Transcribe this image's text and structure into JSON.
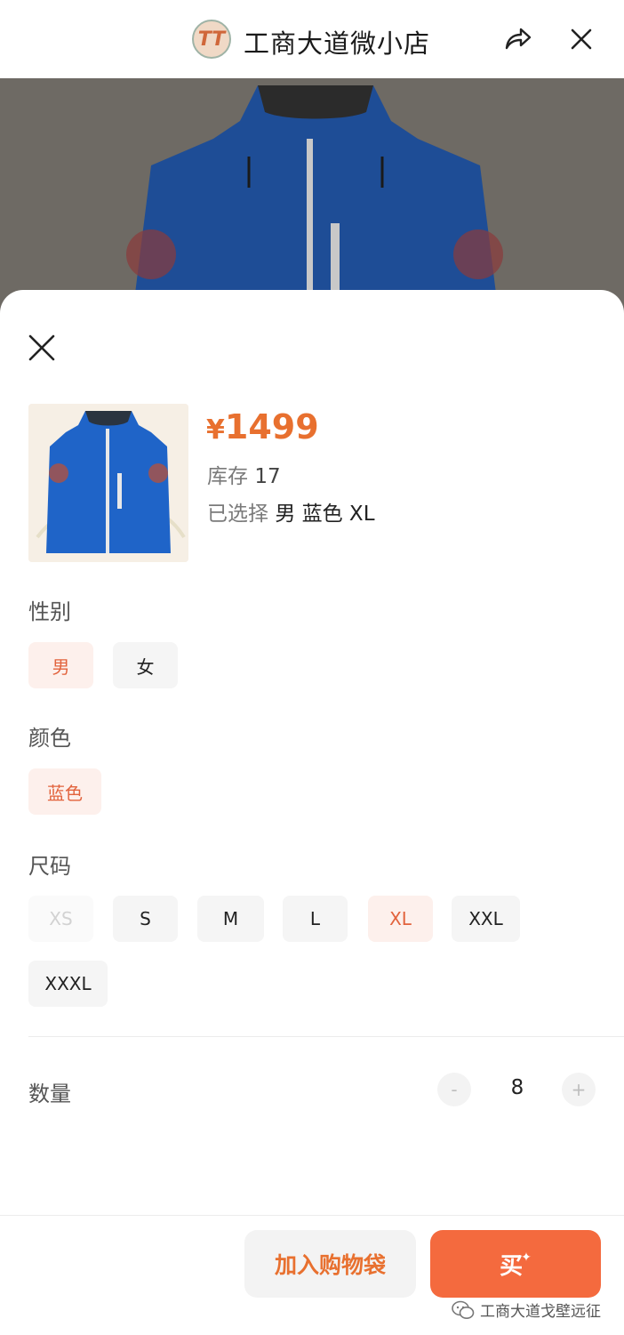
{
  "header": {
    "shop_title": "工商大道微小店",
    "logo_text": "TT"
  },
  "product": {
    "price_symbol": "¥",
    "price_value": "1499",
    "stock_label": "库存",
    "stock_value": "17",
    "selected_label": "已选择",
    "selected_value": "男 蓝色 XL"
  },
  "options": {
    "gender": {
      "label": "性别",
      "items": [
        {
          "label": "男",
          "state": "selected"
        },
        {
          "label": "女",
          "state": "normal"
        }
      ]
    },
    "color": {
      "label": "颜色",
      "items": [
        {
          "label": "蓝色",
          "state": "selected"
        }
      ]
    },
    "size": {
      "label": "尺码",
      "items": [
        {
          "label": "XS",
          "state": "disabled"
        },
        {
          "label": "S",
          "state": "normal"
        },
        {
          "label": "M",
          "state": "normal"
        },
        {
          "label": "L",
          "state": "normal"
        },
        {
          "label": "XL",
          "state": "selected"
        },
        {
          "label": "XXL",
          "state": "normal"
        },
        {
          "label": "XXXL",
          "state": "normal"
        }
      ]
    }
  },
  "quantity": {
    "label": "数量",
    "minus": "-",
    "value": "8",
    "plus": "+"
  },
  "actions": {
    "add_to_bag": "加入购物袋",
    "buy": "买"
  },
  "watermark": "工商大道戈壁远征",
  "colors": {
    "accent": "#e8702f",
    "buy_button": "#f46a3e",
    "selected_bg": "#fdf0ec",
    "jacket_blue": "#1f64c8"
  },
  "icons": [
    "share-icon",
    "close-icon",
    "sheet-close-icon",
    "wechat-icon"
  ]
}
